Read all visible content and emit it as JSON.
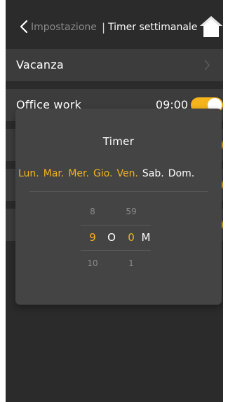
{
  "header": {
    "back_icon": "chevron-left-icon",
    "parent": "Impostazione",
    "separator": "|",
    "title": "Timer settimanale",
    "home_icon": "home-icon"
  },
  "list": {
    "rows": [
      {
        "label": "Vacanza",
        "trailing": "chevron-right-icon"
      },
      {
        "label": "Office work",
        "time": "09:00",
        "toggle": true
      }
    ]
  },
  "dialog": {
    "title": "Timer",
    "days": [
      {
        "label": "Lun.",
        "active": true
      },
      {
        "label": "Mar.",
        "active": true
      },
      {
        "label": "Mer.",
        "active": true
      },
      {
        "label": "Gio.",
        "active": true
      },
      {
        "label": "Ven.",
        "active": true
      },
      {
        "label": "Sab.",
        "active": false
      },
      {
        "label": "Dom.",
        "active": false
      }
    ],
    "picker": {
      "hour_prev": "8",
      "hour": "9",
      "hour_next": "10",
      "sep": "O",
      "minute_prev": "59",
      "minute": "0",
      "minute_next": "1",
      "suffix": "M"
    }
  },
  "colors": {
    "accent": "#f5b31c",
    "background": "#2b2b2b",
    "row": "#3c3c3c",
    "dialog": "#444444"
  }
}
